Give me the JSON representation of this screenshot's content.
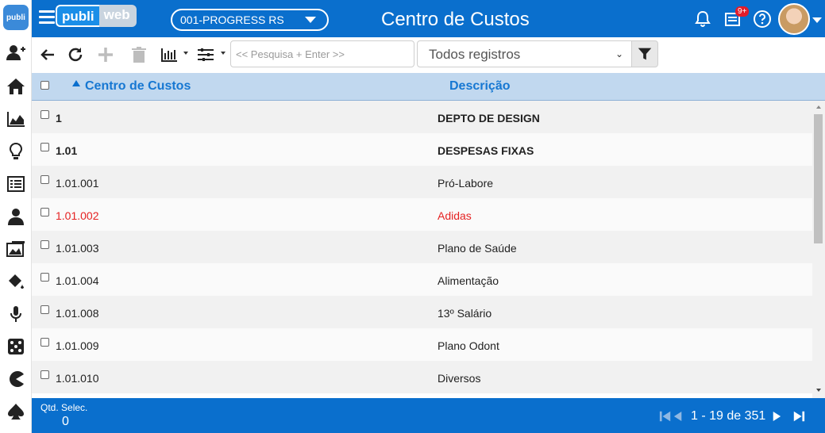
{
  "rail": {
    "logo_text": "publi",
    "icons": [
      "add-user-icon",
      "home-icon",
      "chart-area-icon",
      "lightbulb-icon",
      "list-icon",
      "person-icon",
      "media-icon",
      "paint-bucket-icon",
      "microphone-icon",
      "dice-icon",
      "pacman-icon",
      "spade-icon"
    ]
  },
  "header": {
    "brand_left": "publi",
    "brand_right": "web",
    "company_value": "001-PROGRESS RS",
    "title": "Centro de Custos",
    "notification_badge": "9+"
  },
  "toolbar": {
    "search_placeholder": "<< Pesquisa + Enter >>",
    "filter_selected": "Todos registros"
  },
  "table": {
    "headers": [
      "Centro de Custos",
      "Descrição"
    ],
    "rows": [
      {
        "code": "1",
        "description": "DEPTO DE DESIGN",
        "style": "bold"
      },
      {
        "code": "1.01",
        "description": "DESPESAS FIXAS",
        "style": "bold"
      },
      {
        "code": "1.01.001",
        "description": "Pró-Labore",
        "style": "normal"
      },
      {
        "code": "1.01.002",
        "description": "Adidas",
        "style": "red"
      },
      {
        "code": "1.01.003",
        "description": "Plano de Saúde",
        "style": "normal"
      },
      {
        "code": "1.01.004",
        "description": "Alimentação",
        "style": "normal"
      },
      {
        "code": "1.01.008",
        "description": "13º Salário",
        "style": "normal"
      },
      {
        "code": "1.01.009",
        "description": "Plano Odont",
        "style": "normal"
      },
      {
        "code": "1.01.010",
        "description": "Diversos",
        "style": "normal"
      }
    ]
  },
  "footer": {
    "qtd_label": "Qtd. Selec.",
    "qtd_value": "0",
    "pager_text": "1 - 19 de 351"
  },
  "colors": {
    "primary": "#0a6fcd",
    "header_row": "#c1d8ef",
    "accent_text": "#1677d2",
    "highlight_red": "#e52222"
  }
}
